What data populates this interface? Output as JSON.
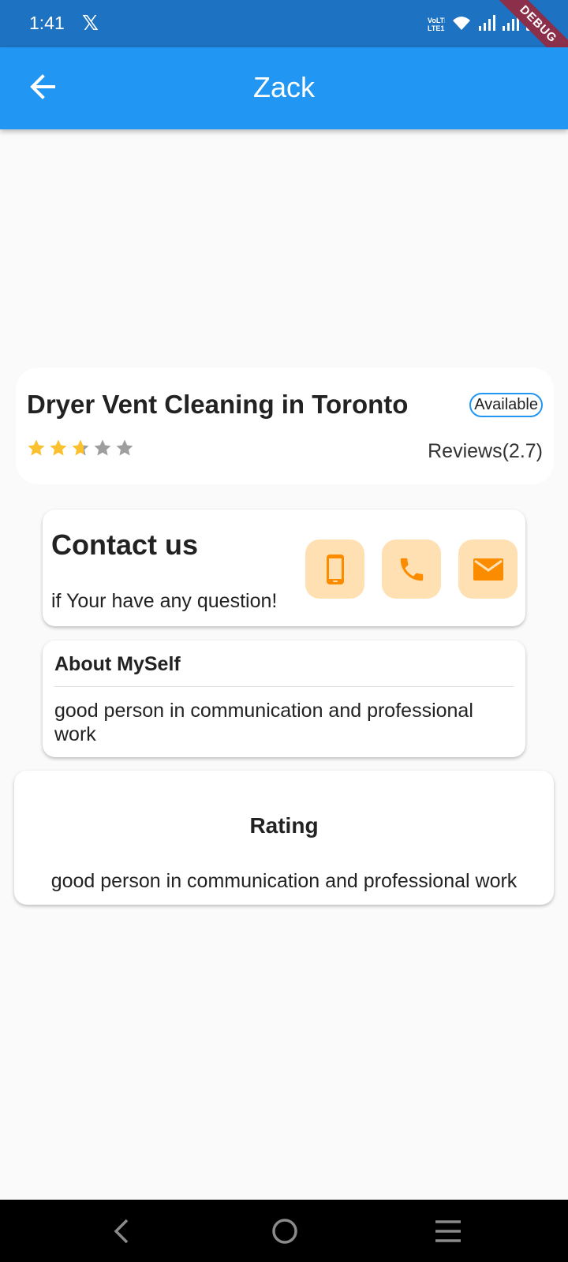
{
  "status_bar": {
    "time": "1:41",
    "x_logo": "𝕏",
    "debug_label": "DEBUG",
    "icons": [
      "volte-icon",
      "wifi-icon",
      "signal-icon",
      "signal-icon-2",
      "battery-icon"
    ]
  },
  "app_bar": {
    "title": "Zack",
    "back_icon": "arrow-left-icon"
  },
  "service": {
    "title": "Dryer Vent Cleaning in Toronto",
    "badge": "Available",
    "rating_stars": 2.7,
    "reviews": "Reviews(2.7)"
  },
  "contact": {
    "title": "Contact us",
    "subtitle": "if Your have any question!",
    "buttons": [
      "phone-device-icon",
      "call-icon",
      "email-icon"
    ]
  },
  "about": {
    "title": "About MySelf",
    "text": "good person in communication and professional work"
  },
  "rating": {
    "title": "Rating",
    "text": "good person in communication and professional work"
  },
  "colors": {
    "status_bar": "#1d72c2",
    "app_bar": "#2196f3",
    "star_filled": "#fbc02d",
    "star_empty": "#9e9e9e",
    "contact_button_bg": "#ffe0b2",
    "contact_icon": "#fb8c00"
  },
  "nav_bar": {
    "icons": [
      "nav-back-icon",
      "nav-home-icon",
      "nav-menu-icon"
    ]
  }
}
